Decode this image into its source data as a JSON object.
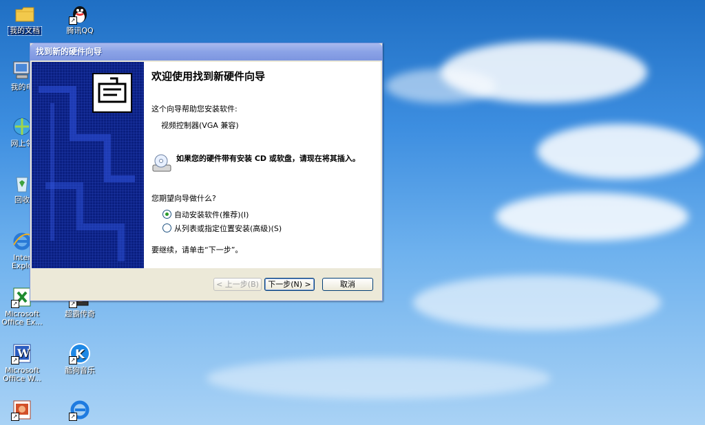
{
  "desktop": {
    "icons": [
      {
        "label": "我的文档",
        "icon": "folder-icon",
        "selected": true
      },
      {
        "label": "腾讯QQ",
        "icon": "qq-penguin-icon"
      },
      {
        "label": "我的电",
        "icon": "computer-icon"
      },
      {
        "label": "网上邻",
        "icon": "network-icon"
      },
      {
        "label": "回收",
        "icon": "recycle-bin-icon"
      },
      {
        "label": "Inter\nExplo",
        "icon": "ie-icon"
      },
      {
        "label": "Microsoft\nOffice Ex...",
        "icon": "excel-icon"
      },
      {
        "label": "超霸传奇",
        "icon": "game-icon"
      },
      {
        "label": "Microsoft\nOffice W...",
        "icon": "word-icon"
      },
      {
        "label": "酷狗音乐",
        "icon": "kugou-icon"
      },
      {
        "label": "",
        "icon": "powerpoint-icon"
      },
      {
        "label": "",
        "icon": "ie-browser-icon"
      }
    ]
  },
  "dialog": {
    "title": "找到新的硬件向导",
    "heading": "欢迎使用找到新硬件向导",
    "intro": "这个向导帮助您安装软件:",
    "device": "视频控制器(VGA 兼容)",
    "cd_notice": "如果您的硬件带有安装 CD 或软盘，请现在将其插入。",
    "question": "您期望向导做什么?",
    "options": [
      {
        "label": "自动安装软件(推荐)(I)",
        "checked": true
      },
      {
        "label": "从列表或指定位置安装(高级)(S)",
        "checked": false
      }
    ],
    "continue_text": "要继续，请单击“下一步”。",
    "buttons": {
      "back": "< 上一步(B)",
      "next": "下一步(N) >",
      "cancel": "取消"
    }
  }
}
